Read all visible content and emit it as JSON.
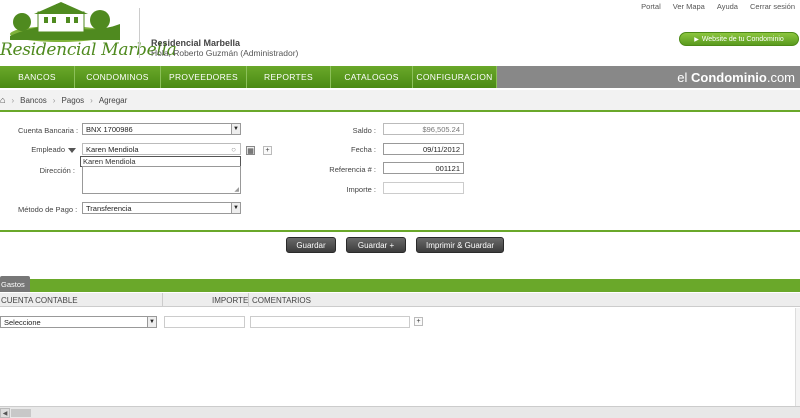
{
  "header": {
    "logo_text": "Residencial Marbella",
    "site_name": "Residencial Marbella",
    "greeting": "Hola, Roberto Guzmán (Administrador)",
    "top_links": [
      "Portal",
      "Ver Mapa",
      "Ayuda",
      "Cerrar sesión"
    ],
    "website_button": "Website de tu Condominio"
  },
  "nav": {
    "items": [
      "BANCOS",
      "CONDOMINOS",
      "PROVEEDORES",
      "REPORTES",
      "CATALOGOS",
      "CONFIGURACION"
    ],
    "brand_prefix": "el ",
    "brand_bold": "Condominio",
    "brand_suffix": ".com"
  },
  "breadcrumb": [
    "Bancos",
    "Pagos",
    "Agregar"
  ],
  "form": {
    "cuenta_label": "Cuenta Bancaria :",
    "cuenta_value": "BNX 1700986",
    "empleado_label": "Empleado",
    "empleado_value": "Karen Mendiola",
    "empleado_suggestion": "Karen Mendiola",
    "direccion_label": "Dirección :",
    "metodo_label": "Método de Pago :",
    "metodo_value": "Transferencia",
    "saldo_label": "Saldo :",
    "saldo_value": "$96,505.24",
    "fecha_label": "Fecha :",
    "fecha_value": "09/11/2012",
    "referencia_label": "Referencia # :",
    "referencia_value": "001121",
    "importe_label": "Importe :",
    "importe_value": ""
  },
  "buttons": {
    "guardar": "Guardar",
    "guardar_mas": "Guardar +",
    "imprimir": "Imprimir & Guardar"
  },
  "gastos": {
    "tab": "Gastos",
    "col_cuenta": "CUENTA CONTABLE",
    "col_importe": "IMPORTE",
    "col_comentarios": "COMENTARIOS",
    "select_value": "Seleccione"
  },
  "colors": {
    "accent_green": "#6aa82a",
    "nav_gray": "#888888",
    "button_dark": "#3c3c3c"
  }
}
